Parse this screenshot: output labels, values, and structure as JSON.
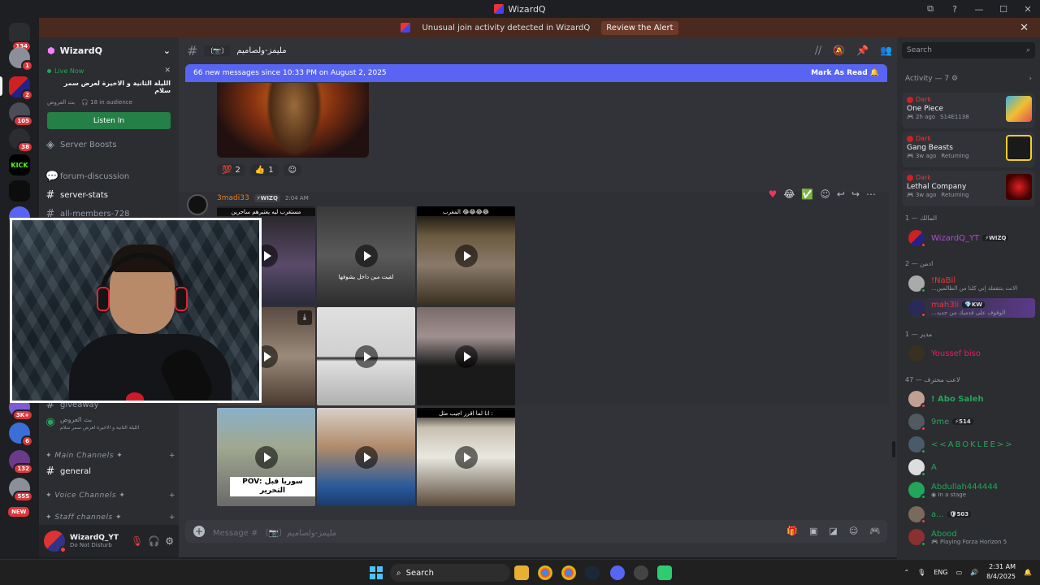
{
  "window": {
    "title": "WizardQ",
    "controls": [
      "⧉",
      "?",
      "—",
      "☐",
      "✕"
    ]
  },
  "alert": {
    "text": "Unusual join activity detected in WizardQ",
    "button": "Review the Alert",
    "close": "✕"
  },
  "rail": {
    "badges": [
      "134",
      "1",
      "2",
      "105",
      "38",
      "3K+",
      "6",
      "132",
      "555",
      "NEW"
    ],
    "kick_label": "KICK"
  },
  "server": {
    "name": "WizardQ",
    "live": {
      "label": "Live Now",
      "title": "الليلة الثانية و الاخيرة لعرض سمر سلام",
      "stage": "بث العروض",
      "audience": "18 in audience",
      "button": "Listen In",
      "close": "✕"
    },
    "channels": {
      "boosts": "Server Boosts",
      "forum": "forum-discussion",
      "stats": "server-stats",
      "members": "all-members-728",
      "giveaway": "giveaway",
      "stage_name": "بث العروض",
      "stage_sub": "الليلة الثانية و الاخيرة لعرض سمر سلام",
      "cat_main": "✦ Main Channels ✦",
      "general": "general",
      "cat_voice": "✦ Voice Channels ✦",
      "cat_staff": "✦ Staff channels ✦"
    }
  },
  "user": {
    "name": "WizardQ_YT",
    "status": "Do Not Disturb"
  },
  "channel": {
    "name": "مليمز-ولصاميم",
    "new_banner": "66 new messages since 10:33 PM on August 2, 2025",
    "mark_read": "Mark As Read",
    "reactions": [
      {
        "emoji": "💯",
        "count": "2"
      },
      {
        "emoji": "👍",
        "count": "1"
      }
    ],
    "message": {
      "author": "3madi33",
      "tag": "⚡WIZQ",
      "time": "2:04 AM"
    },
    "video_captions": {
      "v1": "مستغرب ليه يعتبرهم ساحرين",
      "v2": "لقيت مين داخل يشوفها",
      "v3": "المغرب 😂😂😂😂",
      "v7": "POV: سوريا قبل التحرير",
      "v9": "انا لما اقرر اجيب مثل :"
    },
    "input_placeholder": "Message # 〔📷〕مليمز-ولصاميم"
  },
  "members": {
    "search_placeholder": "Search",
    "activity_header": "Activity — 7",
    "activities": [
      {
        "user": "Dark",
        "game": "One Piece",
        "time": "2h ago",
        "detail": "S14E1138"
      },
      {
        "user": "Dark",
        "game": "Gang Beasts",
        "time": "3w ago",
        "detail": "Returning"
      },
      {
        "user": "Dark",
        "game": "Lethal Company",
        "time": "3w ago",
        "detail": "Returning"
      }
    ],
    "groups": [
      {
        "label": "المالك — 1",
        "members": [
          {
            "name": "WizardQ_YT",
            "tag": "⚡WIZQ",
            "color": "#b24bd1",
            "sub": ""
          }
        ]
      },
      {
        "label": "ادمن — 2",
        "members": [
          {
            "name": "!NaBil",
            "tag": "",
            "color": "#e23b3b",
            "sub": "...الانت بتتقفلة إني كلنا من الظالمين"
          },
          {
            "name": "mah3li",
            "tag": "💎KW",
            "color": "#e23b3b",
            "sub": "...الوقوف على قدميك من جديد"
          }
        ]
      },
      {
        "label": "مدير — 1",
        "members": [
          {
            "name": "Youssef biso",
            "tag": "",
            "color": "#e91e63",
            "sub": ""
          }
        ]
      },
      {
        "label": "لاعب محترف — 47",
        "members": [
          {
            "name": "! Abo Saleh",
            "tag": "",
            "color": "#23a55a",
            "sub": ""
          },
          {
            "name": "9me",
            "tag": "⚡514",
            "color": "#23a55a",
            "sub": ""
          },
          {
            "name": "<<ABOKLEE>>",
            "tag": "",
            "color": "#23a55a",
            "sub": ""
          },
          {
            "name": "A",
            "tag": "",
            "color": "#23a55a",
            "sub": ""
          },
          {
            "name": "Abdullah444444",
            "tag": "",
            "color": "#23a55a",
            "sub": "In a stage"
          },
          {
            "name": "a...",
            "tag": "🛡503",
            "color": "#23a55a",
            "sub": ""
          },
          {
            "name": "Abood",
            "tag": "",
            "color": "#23a55a",
            "sub": "Playing Forza Horizon 5"
          }
        ]
      }
    ]
  },
  "taskbar": {
    "search": "Search",
    "lang": "ENG",
    "time": "2:31 AM",
    "date": "8/4/2025"
  }
}
